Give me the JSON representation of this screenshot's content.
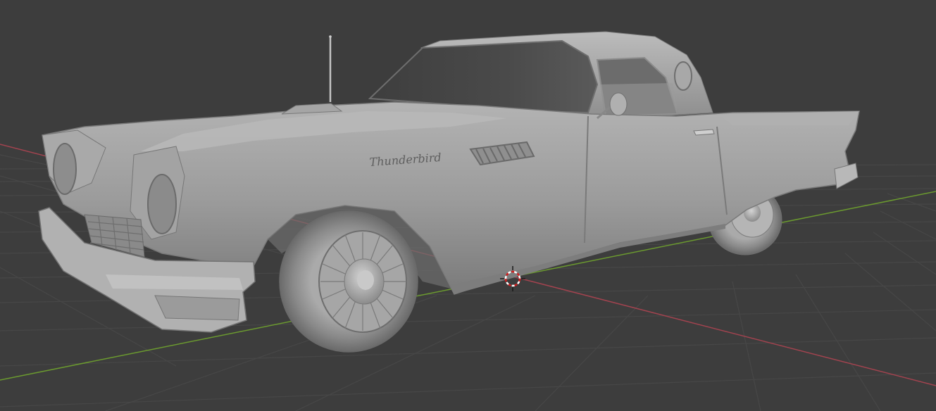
{
  "viewport": {
    "background": "#3d3d3d",
    "grid_color": "#474747",
    "axis_x_color": "#a2434f",
    "axis_y_color": "#6b9a2f",
    "grid_visible": true
  },
  "scene": {
    "object": "car",
    "shading": "solid",
    "body_color": "#9c9c9c",
    "badge_text": "Thunderbird"
  },
  "cursor_3d": {
    "icon": "3d-cursor-icon",
    "colors": [
      "#d21f1f",
      "#ffffff"
    ]
  }
}
